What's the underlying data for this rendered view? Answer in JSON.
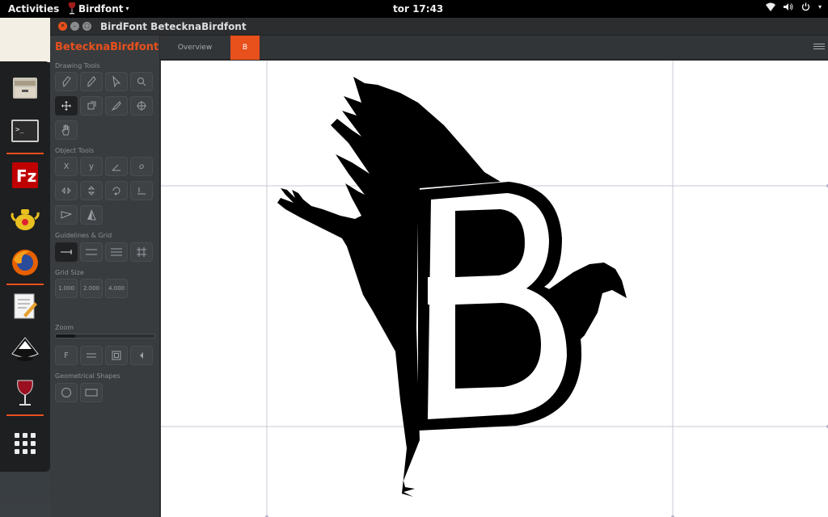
{
  "topbar": {
    "activities": "Activities",
    "app_menu": "Birdfont",
    "clock": "tor 17:43"
  },
  "dock": {
    "items": [
      {
        "name": "files-icon"
      },
      {
        "name": "terminal-icon"
      },
      {
        "name": "filezilla-icon"
      },
      {
        "name": "teapot-icon"
      },
      {
        "name": "firefox-icon"
      },
      {
        "name": "text-editor-icon"
      },
      {
        "name": "inkscape-icon"
      },
      {
        "name": "wine-icon"
      },
      {
        "name": "show-applications-icon"
      }
    ]
  },
  "window": {
    "title": "BirdFont BetecknaBirdfont",
    "font_name": "BetecknaBirdfont",
    "accent_color": "#e8501c",
    "sections": {
      "drawing_tools": "Drawing Tools",
      "object_tools": "Object Tools",
      "guidelines_grid": "Guidelines & Grid",
      "grid_size": "Grid Size",
      "zoom": "Zoom",
      "geometrical_shapes": "Geometrical Shapes"
    },
    "object_tools": {
      "x_label": "X",
      "y_label": "y",
      "italic_label": "o"
    },
    "grid_sizes": [
      "1.000",
      "2.000",
      "4.000"
    ],
    "zoom_level": 0.2,
    "zoom_f_label": "F",
    "tabs": [
      {
        "label": "Overview",
        "active": false
      },
      {
        "label": "B",
        "active": true
      }
    ]
  }
}
